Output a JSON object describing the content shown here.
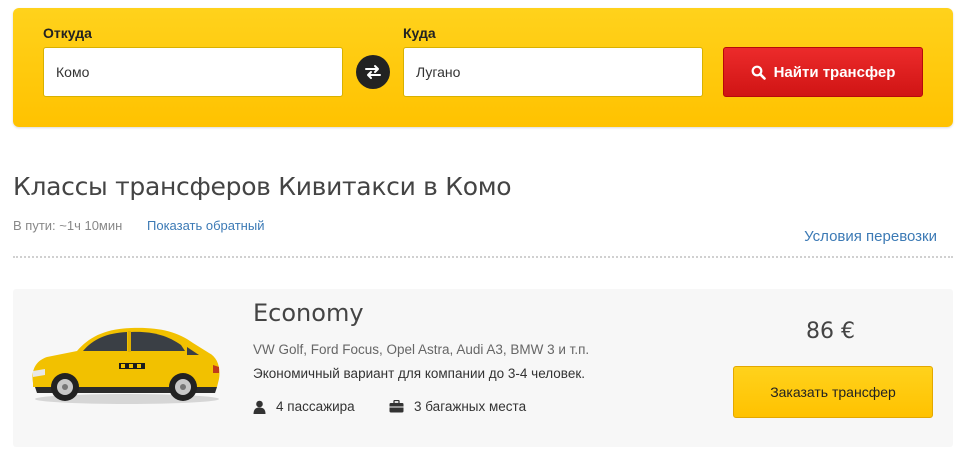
{
  "search": {
    "from_label": "Откуда",
    "from_value": "Комо",
    "to_label": "Куда",
    "to_value": "Лугано",
    "swap_icon": "swap-arrows-icon",
    "find_label": "Найти трансфер",
    "find_icon": "search-icon"
  },
  "header": {
    "title": "Классы трансферов Кивитакси в Комо",
    "duration": "В пути: ~1ч 10мин",
    "reverse_link": "Показать обратный",
    "terms_link": "Условия перевозки"
  },
  "card": {
    "class_name": "Economy",
    "models": "VW Golf, Ford Focus, Opel Astra, Audi A3, BMW 3 и т.п.",
    "description": "Экономичный вариант для компании до 3-4 человек.",
    "passengers": "4 пассажира",
    "luggage": "3 багажных места",
    "price": "86  €",
    "order_label": "Заказать трансфер"
  },
  "colors": {
    "brand_yellow": "#ffc700",
    "find_red": "#d91a1a",
    "link_blue": "#3c7ab5"
  }
}
